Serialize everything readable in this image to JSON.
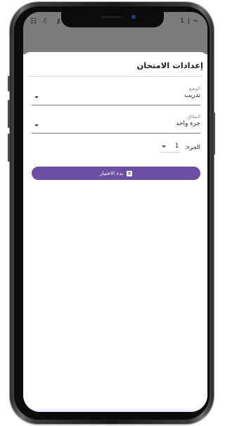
{
  "status_bar": {
    "left_icons": [
      "grid-icon",
      "moon-icon",
      "key-icon"
    ],
    "right_text": "1 | ⏦"
  },
  "sheet": {
    "title": "إعدادات الامتحان"
  },
  "mode_field": {
    "label": "الوضع",
    "value": "تدريب"
  },
  "scope_field": {
    "label": "النطاق",
    "value": "جزء واحد"
  },
  "part_field": {
    "label": "الجزء:",
    "value": "1"
  },
  "start_button": {
    "label": "بدء الاختبار"
  },
  "colors": {
    "accent": "#6b4fa3",
    "status_bar": "#7b7b7b"
  }
}
